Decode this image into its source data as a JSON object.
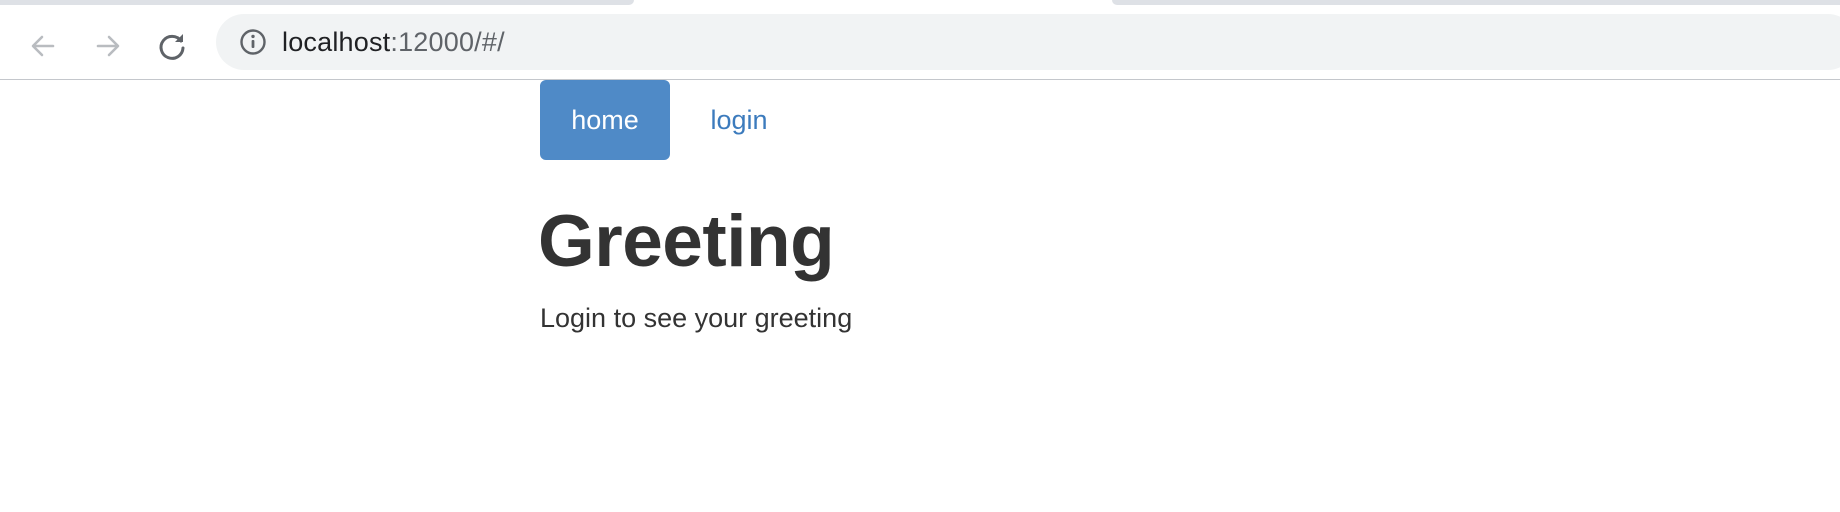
{
  "browser": {
    "url_host": "localhost",
    "url_rest": ":12000/#/"
  },
  "nav": {
    "items": [
      {
        "label": "home",
        "active": true
      },
      {
        "label": "login",
        "active": false
      }
    ]
  },
  "main": {
    "title": "Greeting",
    "message": "Login to see your greeting"
  },
  "colors": {
    "active_pill": "#4f8ac7",
    "link": "#3c7bbd",
    "text": "#333333"
  },
  "icons": [
    "back-arrow-icon",
    "forward-arrow-icon",
    "reload-icon",
    "info-icon"
  ]
}
